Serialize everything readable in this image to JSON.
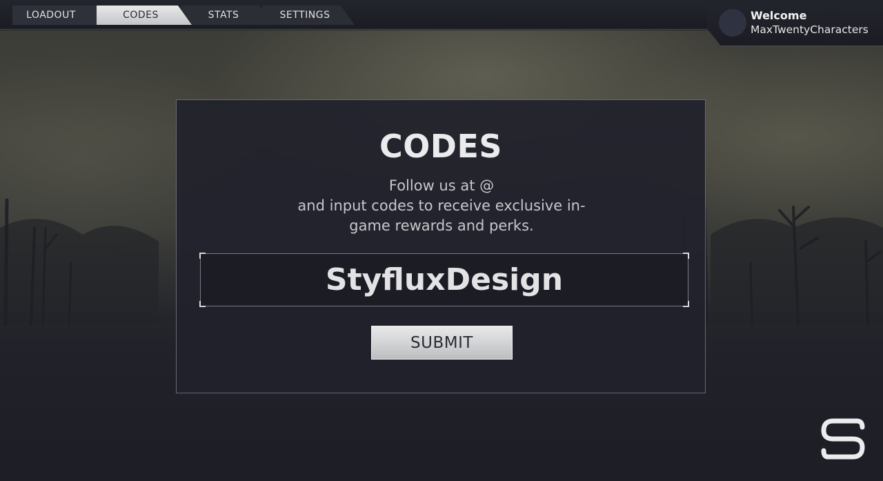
{
  "nav": {
    "tabs": [
      {
        "label": "LOADOUT",
        "active": false
      },
      {
        "label": "CODES",
        "active": true
      },
      {
        "label": "STATS",
        "active": false
      },
      {
        "label": "SETTINGS",
        "active": false
      }
    ]
  },
  "user": {
    "welcome_label": "Welcome",
    "username": "MaxTwentyCharacters"
  },
  "codes": {
    "title": "CODES",
    "description": "Follow us at @\nand input codes to receive exclusive in-game rewards and perks.",
    "input_value": "StyfluxDesign",
    "submit_label": "SUBMIT"
  },
  "brand": {
    "logo_icon": "styflux-s-logo-icon"
  },
  "colors": {
    "panel_bg": "#20212b",
    "accent_light": "#e9e9ea",
    "text_light": "#ebebed"
  }
}
